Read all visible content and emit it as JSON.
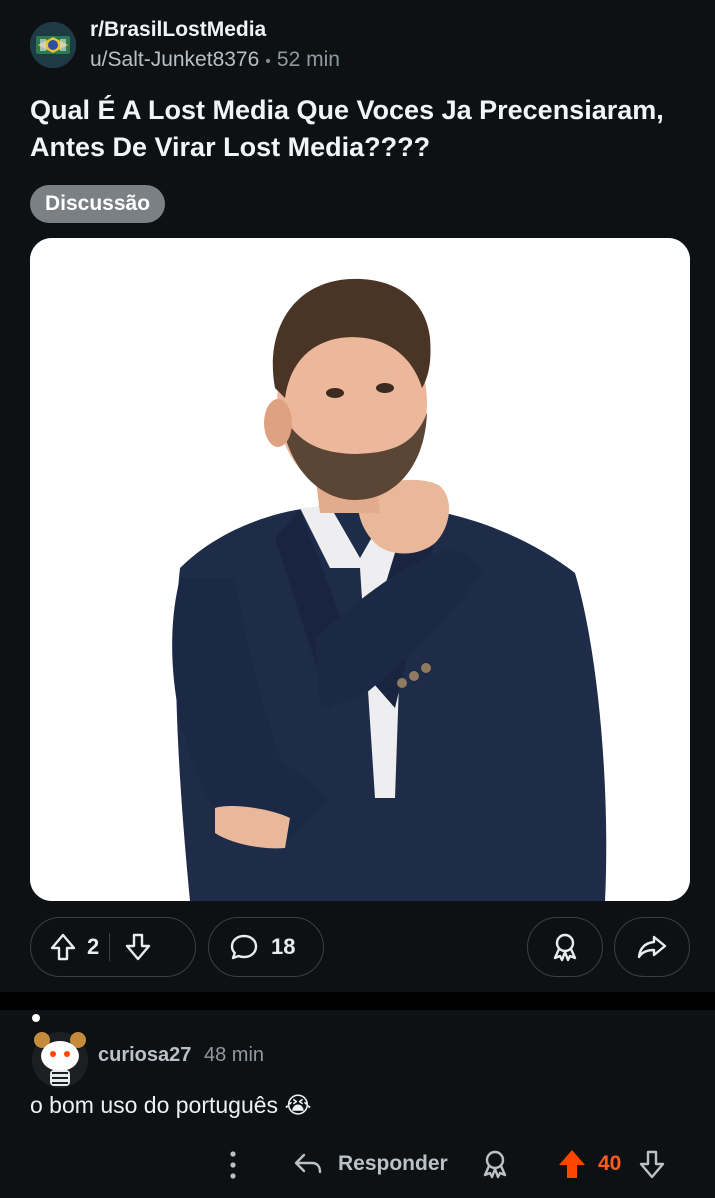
{
  "post": {
    "subreddit": "r/BrasilLostMedia",
    "author": "u/Salt-Junket8376",
    "separator": "•",
    "time": "52 min",
    "title": "Qual É A Lost Media Que Voces Ja Precensiaram, Antes De Virar Lost Media????",
    "flair": "Discussão",
    "image_icon": "thinking-man-photo"
  },
  "actions": {
    "upvote_icon": "upvote-icon",
    "score": "2",
    "downvote_icon": "downvote-icon",
    "comment_icon": "comment-icon",
    "comment_count": "18",
    "award_icon": "award-icon",
    "share_icon": "share-icon"
  },
  "comment": {
    "username": "curiosa27",
    "time": "48 min",
    "body": "o bom uso do português 😭",
    "reply_label": "Responder",
    "score": "40",
    "score_color": "#ff5a1f"
  },
  "colors": {
    "background": "#0e1113",
    "flair_bg": "#7b8085",
    "accent_upvote": "#ff4500"
  }
}
